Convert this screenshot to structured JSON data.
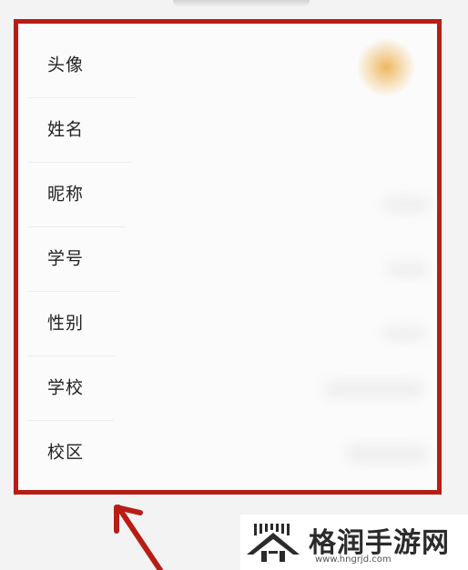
{
  "profile": {
    "rows": [
      {
        "label": "头像"
      },
      {
        "label": "姓名"
      },
      {
        "label": "昵称"
      },
      {
        "label": "学号"
      },
      {
        "label": "性别"
      },
      {
        "label": "学校"
      },
      {
        "label": "校区"
      }
    ]
  },
  "annotation": {
    "frame_color": "#b81d14",
    "arrow_color": "#b81d14"
  },
  "watermark": {
    "name": "格润手游网",
    "url": "www.hngrjd.com"
  }
}
